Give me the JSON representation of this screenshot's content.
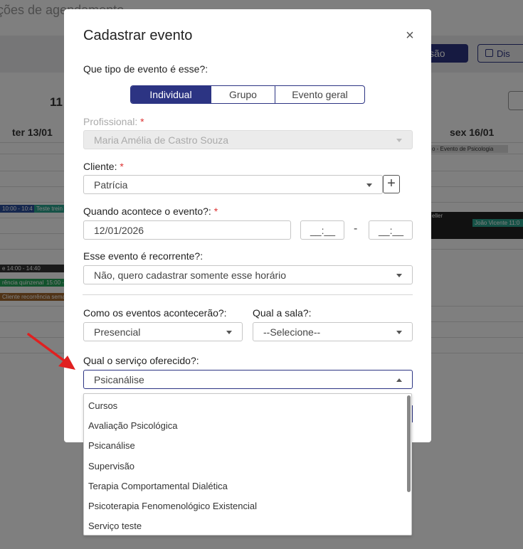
{
  "background": {
    "page_title": "ções de agendamento",
    "primary_button": "ssão",
    "outline_button": "Dis",
    "day_number": "11",
    "col_tue": "ter 13/01",
    "col_fri": "sex 16/01",
    "chips": {
      "fri_top": "o - Evento de Psicologia",
      "tue_1000": "10:00 - 10:4",
      "tue_teste": "Teste trein",
      "fri_eller": "eller",
      "fri_joao": "João Vicente 11:0",
      "tue_1400": "e 14:00 - 14:40",
      "tue_quinzenal": "rência quinzenal",
      "tue_1500": "15:00 -",
      "tue_cliente": "Cliente recorrência sema"
    }
  },
  "modal": {
    "title": "Cadastrar evento",
    "close_label": "×",
    "event_type_label": "Que tipo de evento é esse?:",
    "event_types": [
      "Individual",
      "Grupo",
      "Evento geral"
    ],
    "professional_label": "Profissional:",
    "professional_value": "Maria Amélia de Castro Souza",
    "client_label": "Cliente:",
    "client_value": "Patrícia",
    "add_client_label": "+",
    "when_label": "Quando acontece o evento?:",
    "date_value": "12/01/2026",
    "start_time": "__:__",
    "end_time": "__:__",
    "time_separator": "-",
    "recurrent_label": "Esse evento é recorrente?:",
    "recurrent_value": "Não, quero cadastrar somente esse horário",
    "mode_label": "Como os eventos acontecerão?:",
    "mode_value": "Presencial",
    "room_label": "Qual a sala?:",
    "room_value": "--Selecione--",
    "service_label": "Qual o serviço oferecido?:",
    "service_value": "Psicanálise",
    "required_mark": "*"
  },
  "service_options": [
    "Cursos",
    "Avaliação Psicológica",
    "Psicanálise",
    "Supervisão",
    "Terapia Comportamental Dialética",
    "Psicoterapia Fenomenológico Existencial",
    "Serviço teste"
  ],
  "colors": {
    "primary": "#2c3483",
    "required": "#dd3333",
    "arrow": "#e02020",
    "overlay": "rgba(0,0,0,0.5)"
  },
  "icons": [
    "close-icon",
    "plus-icon",
    "chevron-down-icon",
    "chevron-up-icon",
    "calendar-icon",
    "red-arrow-annotation"
  ]
}
